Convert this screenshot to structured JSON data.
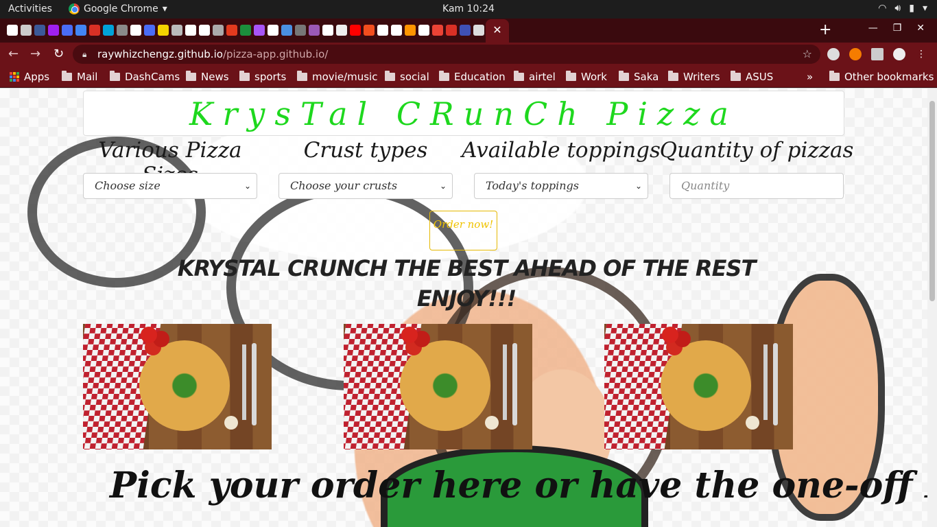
{
  "os": {
    "activities": "Activities",
    "app_name": "Google Chrome",
    "clock": "Kam 10:24"
  },
  "tab_favicon_colors": [
    "#ffffff",
    "#cccccc",
    "#3b5998",
    "#a020f0",
    "#4a6cf7",
    "#4285f4",
    "#d93025",
    "#00a3d9",
    "#8a8a8a",
    "#ffffff",
    "#4a6cf7",
    "#f5d300",
    "#bbbbbb",
    "#ffffff",
    "#ffffff",
    "#aaaaaa",
    "#e23a1e",
    "#1b8f3c",
    "#a855f7",
    "#ffffff",
    "#4a90e2",
    "#777777",
    "#9b59b6",
    "#ffffff",
    "#eeeeee",
    "#ff0000",
    "#f24e1e",
    "#ffffff",
    "#ffffff",
    "#ff9500",
    "#ffffff",
    "#ea4335",
    "#d93025",
    "#3f51b5",
    "#dddddd"
  ],
  "tab_favicon_colors_right": [
    "#ffffff",
    "#ffffff",
    "#1e88e5",
    "#00bcd4",
    "#ff0000",
    "#aaaaaa",
    "#111111",
    "#ffffff",
    "#e50914",
    "#ffffff",
    "#6c5ce7",
    "#1db954",
    "#8e44ad",
    "#e91e63",
    "#ff5722",
    "#ff4500",
    "#3b5ce7",
    "#25d366",
    "#ffffff"
  ],
  "browser": {
    "url_host": "raywhizchengz.github.io",
    "url_path": "/pizza-app.github.io/",
    "bookmarks": [
      "Apps",
      "Mail",
      "DashCams",
      "News",
      "sports",
      "movie/music",
      "social",
      "Education",
      "airtel",
      "Work",
      "Saka",
      "Writers",
      "ASUS"
    ],
    "overflow": "»",
    "other_bookmarks": "Other bookmarks"
  },
  "page": {
    "brand": "KrysTal CRunCh Pizza",
    "columns": [
      {
        "label": "Various Pizza Sizes",
        "select": "Choose size"
      },
      {
        "label": "Crust types",
        "select": "Choose your crusts"
      },
      {
        "label": "Available toppings",
        "select": "Today's toppings"
      },
      {
        "label": "Quantity of pizzas",
        "placeholder": "Quantity"
      }
    ],
    "order_button": "Order now!",
    "slogan_line1": "KRYSTAL CRUNCH THE BEST AHEAD OF THE REST",
    "slogan_line2": "ENJOY!!!",
    "pick_text": "Pick your order here or have the one-off Krystal"
  },
  "colors": {
    "brand_green": "#1ed81e",
    "order_yellow": "#f0c300",
    "chrome_theme": "#6b1218"
  }
}
